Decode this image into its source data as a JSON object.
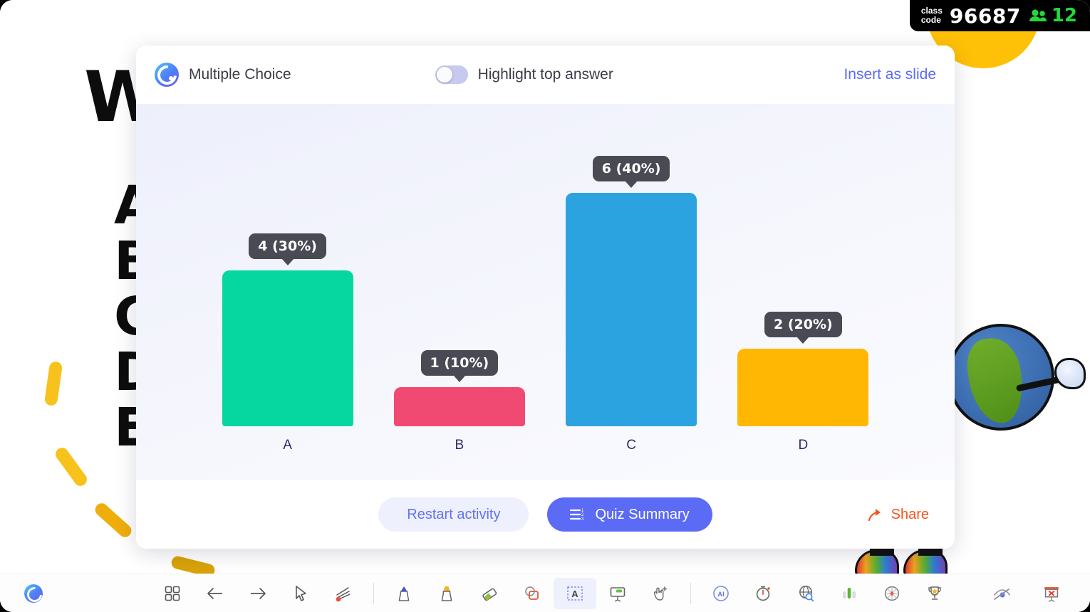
{
  "class_badge": {
    "label_line1": "class",
    "label_line2": "code",
    "code": "96687",
    "participants": "12",
    "participants_color": "#25D83B"
  },
  "background_slide": {
    "title": "W",
    "options": [
      "A",
      "B",
      "C",
      "D",
      "E"
    ]
  },
  "panel": {
    "header": {
      "activity_type": "Multiple Choice",
      "toggle_label": "Highlight top answer",
      "toggle_on": false,
      "insert_as_slide": "Insert as slide"
    },
    "footer": {
      "restart_label": "Restart activity",
      "summary_label": "Quiz Summary",
      "share_label": "Share"
    }
  },
  "chart_data": {
    "type": "bar",
    "title": "Multiple Choice",
    "categories": [
      "A",
      "B",
      "C",
      "D"
    ],
    "values": [
      4,
      1,
      6,
      2
    ],
    "percentages": [
      "30%",
      "10%",
      "40%",
      "20%"
    ],
    "labels": [
      "4 (30%)",
      "1 (10%)",
      "6 (40%)",
      "2 (20%)"
    ],
    "colors": [
      "#06D6A0",
      "#F04A72",
      "#2AA3E0",
      "#FFB703"
    ],
    "xlabel": "",
    "ylabel": "",
    "ylim": [
      0,
      6
    ],
    "grid": false,
    "legend": "none"
  },
  "toolbar": {
    "items": [
      {
        "name": "grid-view-icon",
        "title": "Slide grid"
      },
      {
        "name": "arrow-left-icon",
        "title": "Previous slide"
      },
      {
        "name": "arrow-right-icon",
        "title": "Next slide"
      },
      {
        "name": "cursor-icon",
        "title": "Pointer"
      },
      {
        "name": "laser-pointer-icon",
        "title": "Laser pointer"
      },
      {
        "name": "pen-blue-icon",
        "title": "Pen"
      },
      {
        "name": "highlighter-icon",
        "title": "Highlighter"
      },
      {
        "name": "eraser-icon",
        "title": "Eraser"
      },
      {
        "name": "shapes-icon",
        "title": "Shapes"
      },
      {
        "name": "text-box-icon",
        "title": "Text box",
        "active": true
      },
      {
        "name": "whiteboard-icon",
        "title": "Whiteboard"
      },
      {
        "name": "drag-icon",
        "title": "Drag objects"
      },
      {
        "name": "ai-icon",
        "title": "AI"
      },
      {
        "name": "timer-icon",
        "title": "Timer"
      },
      {
        "name": "browser-icon",
        "title": "Embedded browser"
      },
      {
        "name": "poll-bar-chart-icon",
        "title": "Quick poll"
      },
      {
        "name": "name-picker-icon",
        "title": "Name picker"
      },
      {
        "name": "leaderboard-trophy-icon",
        "title": "Leaderboard"
      }
    ],
    "right_items": [
      {
        "name": "hide-annotations-icon",
        "title": "Hide"
      },
      {
        "name": "exit-presentation-icon",
        "title": "Exit"
      }
    ]
  }
}
